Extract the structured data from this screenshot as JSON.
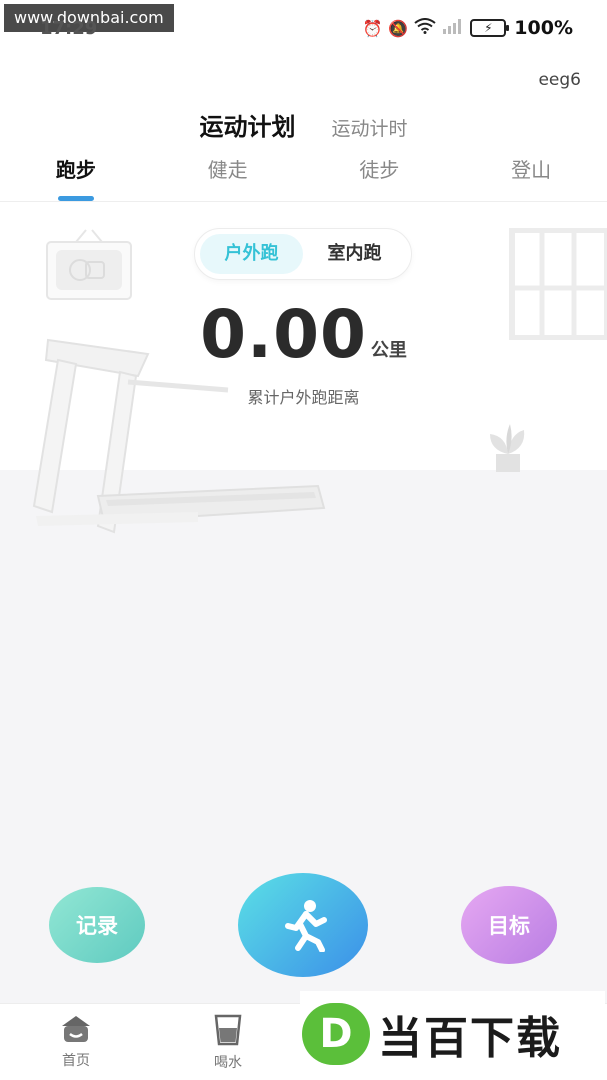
{
  "watermark_top": "www.downbai.com",
  "status_bar": {
    "time": "17:29",
    "battery": "100%",
    "icons": [
      "alarm-icon",
      "mute-icon",
      "wifi-icon",
      "signal-icon",
      "battery-icon"
    ]
  },
  "user": {
    "name": "eeg6"
  },
  "mode_tabs": {
    "active": "运动计划",
    "inactive": "运动计时"
  },
  "sport_tabs": [
    {
      "label": "跑步",
      "active": true
    },
    {
      "label": "健走",
      "active": false
    },
    {
      "label": "徒步",
      "active": false
    },
    {
      "label": "登山",
      "active": false
    }
  ],
  "run_type": {
    "outdoor": "户外跑",
    "indoor": "室内跑",
    "selected": "outdoor"
  },
  "distance": {
    "value": "0.00",
    "unit": "公里",
    "caption": "累计户外跑距离"
  },
  "actions": {
    "record": "记录",
    "start_icon": "running-person-icon",
    "goal": "目标"
  },
  "bottom_nav": [
    {
      "label": "首页",
      "icon": "home-icon"
    },
    {
      "label": "喝水",
      "icon": "water-cup-icon"
    }
  ],
  "watermark_bottom": {
    "logo": "D",
    "text": "当百下载"
  },
  "colors": {
    "accent_blue": "#3b9ae0",
    "toggle_active_text": "#35c2d6",
    "record_green": "#5fcac0",
    "start_blue": "#3b8fe8",
    "goal_purple": "#b97ee3",
    "watermark_green": "#5bbf3a"
  }
}
